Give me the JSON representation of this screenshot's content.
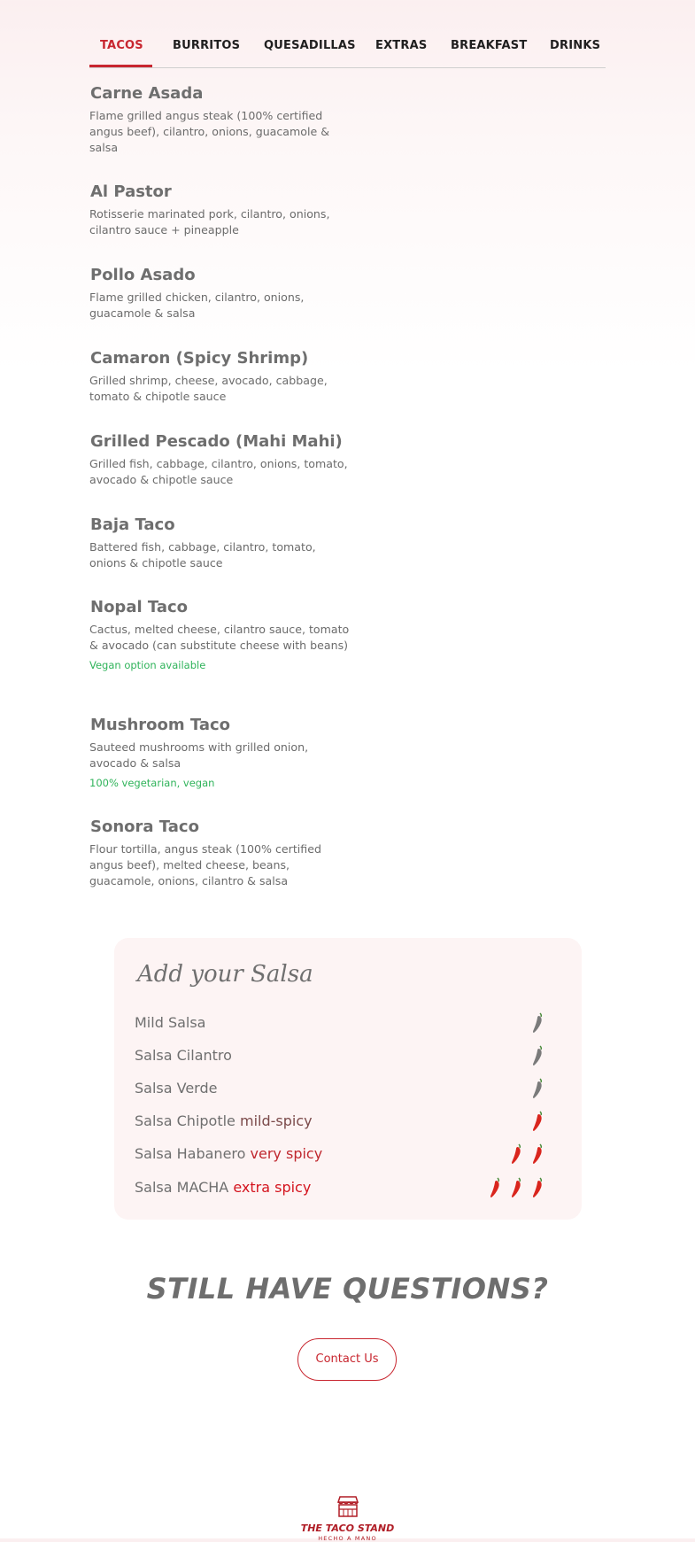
{
  "tabs": [
    {
      "label": "TACOS",
      "active": true
    },
    {
      "label": "BURRITOS",
      "active": false
    },
    {
      "label": "QUESADILLAS",
      "active": false
    },
    {
      "label": "EXTRAS",
      "active": false
    },
    {
      "label": "BREAKFAST",
      "active": false
    },
    {
      "label": "DRINKS",
      "active": false
    }
  ],
  "menu_items": [
    {
      "title": "Carne Asada",
      "description": "Flame grilled angus steak (100% certified angus beef), cilantro, onions, guacamole & salsa",
      "note": ""
    },
    {
      "title": "Al Pastor",
      "description": "Rotisserie marinated pork, cilantro, onions, cilantro sauce + pineapple",
      "note": ""
    },
    {
      "title": "Pollo Asado",
      "description": "Flame grilled chicken, cilantro, onions, guacamole & salsa",
      "note": ""
    },
    {
      "title": "Camaron (Spicy Shrimp)",
      "description": "Grilled shrimp, cheese, avocado, cabbage, tomato & chipotle sauce",
      "note": ""
    },
    {
      "title": "Grilled Pescado (Mahi Mahi)",
      "description": "Grilled fish, cabbage, cilantro, onions, tomato, avocado & chipotle sauce",
      "note": ""
    },
    {
      "title": "Baja Taco",
      "description": "Battered fish, cabbage, cilantro, tomato, onions & chipotle sauce",
      "note": ""
    },
    {
      "title": "Nopal Taco",
      "description": "Cactus, melted cheese, cilantro sauce, tomato & avocado (can substitute cheese with beans)",
      "note": "Vegan option available"
    },
    {
      "title": "Mushroom Taco",
      "description": "Sauteed mushrooms with grilled onion, avocado & salsa",
      "note": "100% vegetarian, vegan"
    },
    {
      "title": "Sonora Taco",
      "description": "Flour tortilla, angus steak (100% certified angus beef), melted cheese, beans, guacamole, onions, cilantro & salsa",
      "note": ""
    }
  ],
  "salsa": {
    "heading": "Add your Salsa",
    "items": [
      {
        "name": "Mild Salsa",
        "heat_label": "",
        "peppers": 1,
        "pepper_color": "#7a7a7a"
      },
      {
        "name": "Salsa Cilantro",
        "heat_label": "",
        "peppers": 1,
        "pepper_color": "#7a7a7a"
      },
      {
        "name": "Salsa Verde",
        "heat_label": "",
        "peppers": 1,
        "pepper_color": "#7a7a7a"
      },
      {
        "name": "Salsa Chipotle",
        "heat_label": "mild-spicy",
        "peppers": 1,
        "pepper_color": "#d9251d"
      },
      {
        "name": "Salsa Habanero",
        "heat_label": "very spicy",
        "peppers": 2,
        "pepper_color": "#d9251d"
      },
      {
        "name": "Salsa MACHA",
        "heat_label": "extra spicy",
        "peppers": 3,
        "pepper_color": "#d9251d"
      }
    ]
  },
  "questions": {
    "heading": "STILL HAVE QUESTIONS?",
    "button_label": "Contact Us"
  },
  "footer": {
    "logo_name": "THE TACO STAND",
    "logo_tagline": "HECHO A MANO"
  },
  "colors": {
    "accent": "#c8262f",
    "vegan_note": "#2fb35a",
    "pepper_hot": "#d9251d",
    "pepper_mild": "#7a7a7a"
  }
}
